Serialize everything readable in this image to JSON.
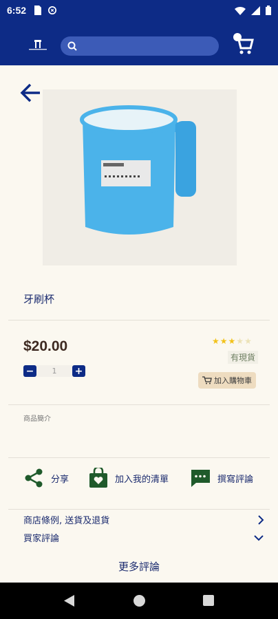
{
  "status_bar": {
    "time": "6:52"
  },
  "header": {
    "search_placeholder": ""
  },
  "product": {
    "name": "牙刷杯",
    "price": "$20.00",
    "quantity": "1",
    "rating": 3,
    "rating_max": 5,
    "stock_label": "有現貨",
    "add_to_cart_label": "加入購物車",
    "intro_label": "商品簡介"
  },
  "actions": {
    "share_label": "分享",
    "wishlist_label": "加入我的清單",
    "review_label": "撰寫評論"
  },
  "sections": {
    "policy_label": "商店條例, 送貨及退貨",
    "reviews_label": "買家評論",
    "more_reviews_label": "更多評論"
  },
  "colors": {
    "brand": "#0d2b86",
    "action_green": "#1f5a2b",
    "star": "#f2c21a",
    "price": "#3e2a21"
  }
}
